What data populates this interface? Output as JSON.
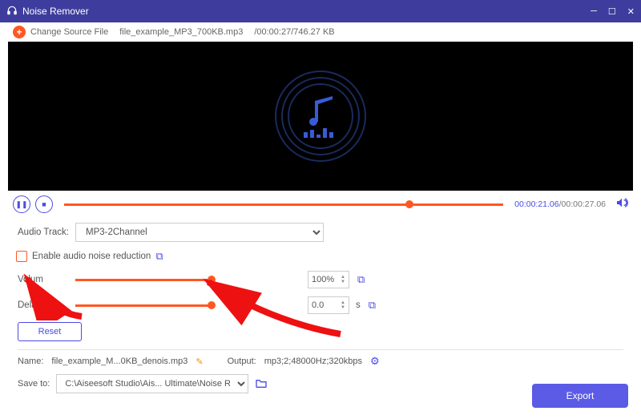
{
  "window": {
    "title": "Noise Remover"
  },
  "top": {
    "change_source": "Change Source File",
    "file_name": "file_example_MP3_700KB.mp3",
    "meta": "/00:00:27/746.27 KB"
  },
  "playback": {
    "current": "00:00:21.06",
    "total": "00:00:27.06",
    "position_pct": 77.8
  },
  "track": {
    "label": "Audio Track:",
    "selected": "MP3-2Channel"
  },
  "noise": {
    "checkbox_label": "Enable audio noise reduction"
  },
  "volume": {
    "label": "Volum",
    "value": "100%"
  },
  "delay": {
    "label": "Delay:",
    "value": "0.0",
    "unit": "s"
  },
  "reset_label": "Reset",
  "output": {
    "name_label": "Name:",
    "name_value": "file_example_M...0KB_denois.mp3",
    "output_label": "Output:",
    "output_value": "mp3;2;48000Hz;320kbps",
    "save_label": "Save to:",
    "save_value": "C:\\Aiseesoft Studio\\Ais... Ultimate\\Noise Remover"
  },
  "export_label": "Export"
}
